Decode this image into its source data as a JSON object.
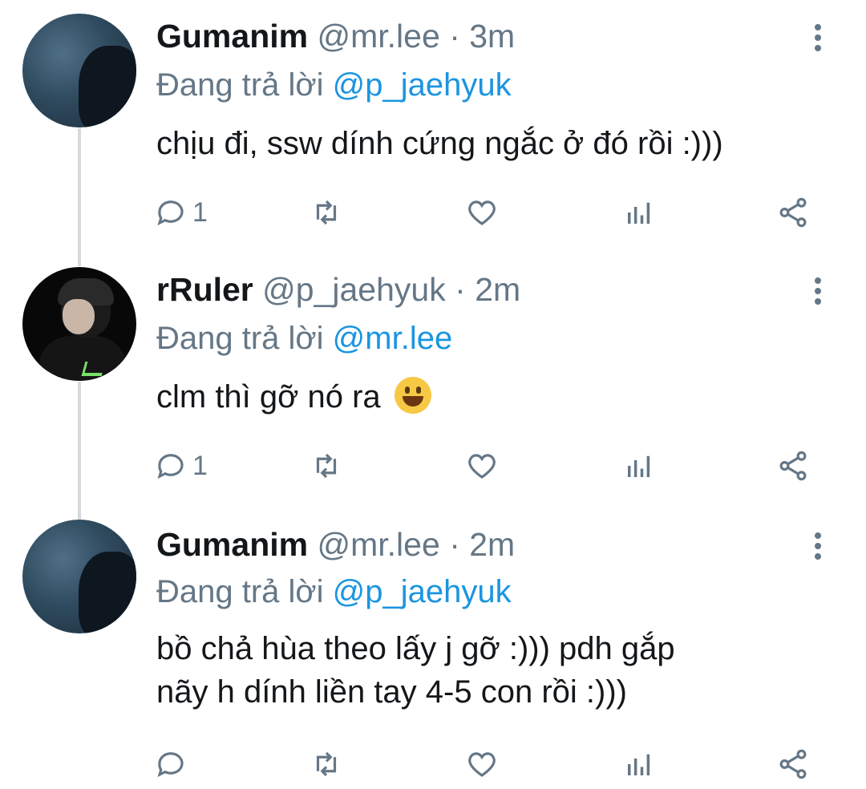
{
  "tweets": [
    {
      "name": "Gumanim",
      "handle": "@mr.lee",
      "separator": "·",
      "time": "3m",
      "reply_prefix": "Đang trả lời",
      "reply_to": "@p_jaehyuk",
      "text_lines": [
        "chịu đi, ssw dính cứng ngắc ở đó rồi :)))"
      ],
      "reply_count": "1",
      "avatar": "blue-silhouette"
    },
    {
      "name": "rRuler",
      "handle": "@p_jaehyuk",
      "separator": "·",
      "time": "2m",
      "reply_prefix": "Đang trả lời",
      "reply_to": "@mr.lee",
      "text_lines": [
        "clm thì gỡ nó ra"
      ],
      "emoji": "grinning-face",
      "reply_count": "1",
      "avatar": "dark-portrait"
    },
    {
      "name": "Gumanim",
      "handle": "@mr.lee",
      "separator": "·",
      "time": "2m",
      "reply_prefix": "Đang trả lời",
      "reply_to": "@p_jaehyuk",
      "text_lines": [
        "bồ chả hùa theo lấy j gỡ :))) pdh gắp",
        "nãy h dính liền tay 4-5 con rồi :)))"
      ],
      "reply_count": "",
      "avatar": "blue-silhouette"
    }
  ],
  "icons": [
    "reply-icon",
    "retweet-icon",
    "like-icon",
    "analytics-icon",
    "share-icon",
    "more-options-icon"
  ],
  "colors": {
    "text": "#14171a",
    "secondary": "#657786",
    "mention": "#1b95e0",
    "thread_line": "#d6dade"
  }
}
